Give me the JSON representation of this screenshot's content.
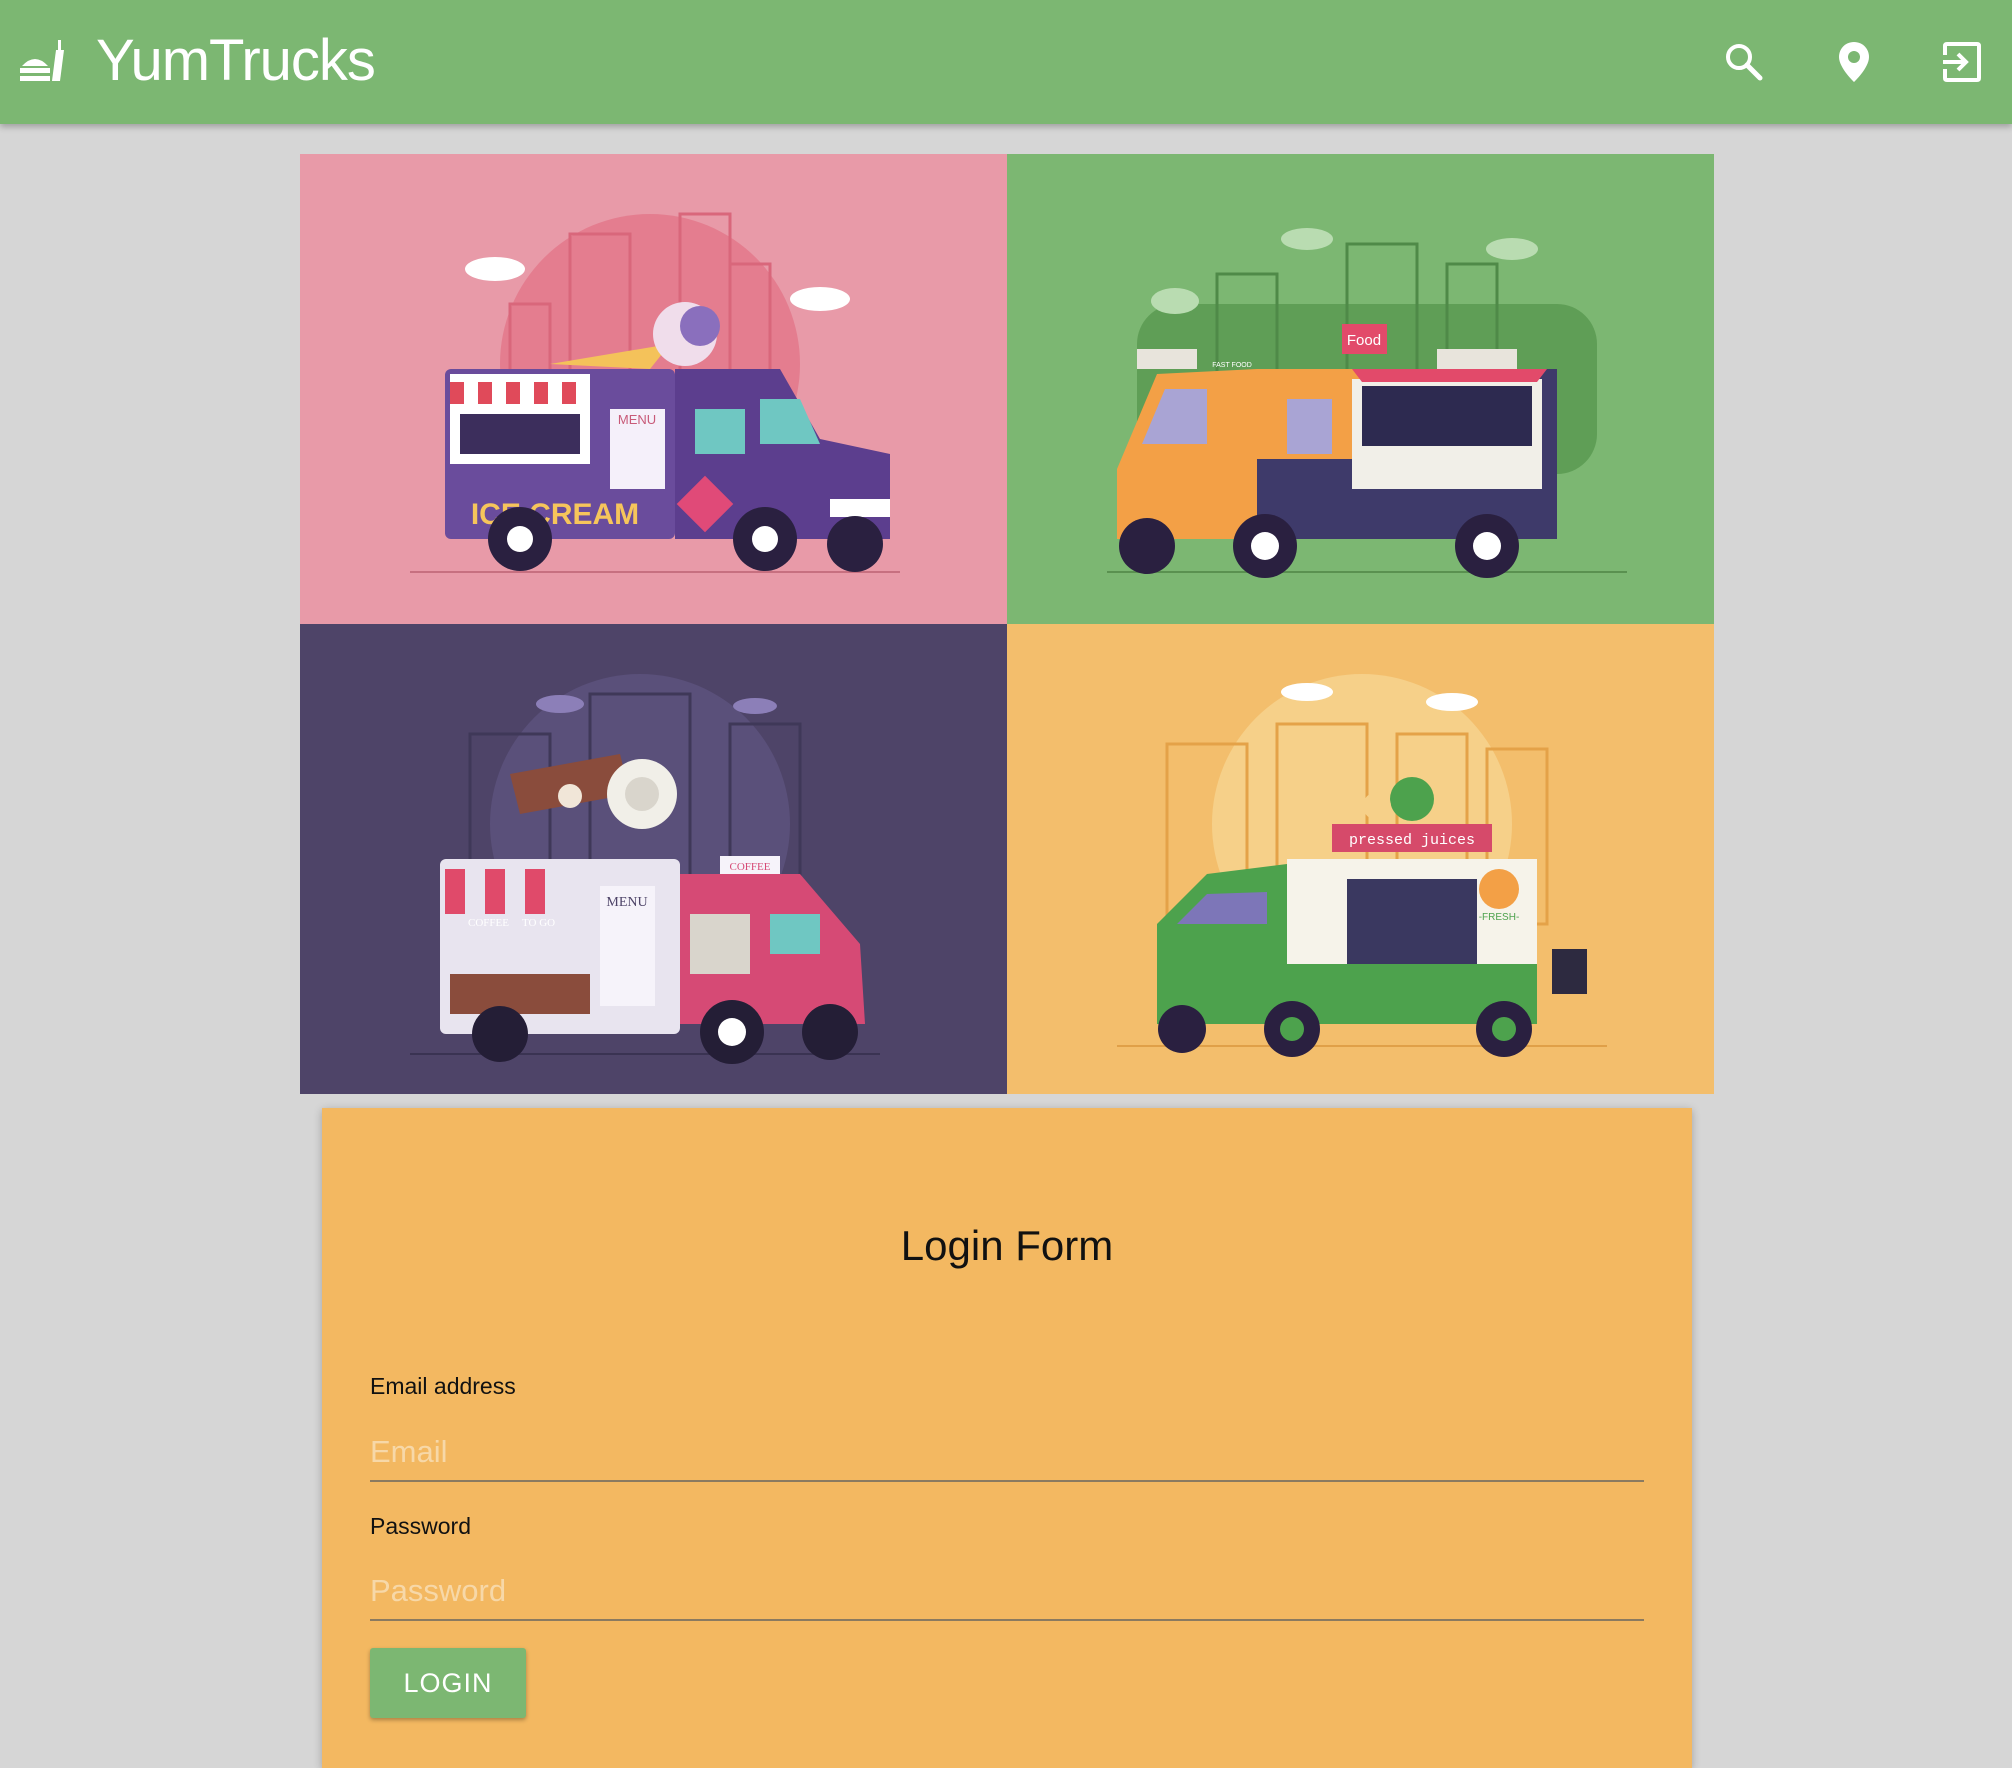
{
  "app": {
    "title": "YumTrucks",
    "brand_color": "#7cb772",
    "icons": [
      "food-truck-icon",
      "search-icon",
      "location-pin-icon",
      "login-icon"
    ]
  },
  "hero": {
    "tiles": [
      {
        "name": "ice-cream-truck",
        "background": "#e89aa8",
        "lettering": [
          "MENU",
          "ICE CREAM"
        ]
      },
      {
        "name": "fast-food-truck",
        "background": "#7cb772",
        "lettering": [
          "Food",
          "FAST FOOD"
        ]
      },
      {
        "name": "coffee-truck",
        "background": "#4e4468",
        "lettering": [
          "COFFEE",
          "COFFEE",
          "TO GO",
          "MENU"
        ]
      },
      {
        "name": "juice-truck",
        "background": "#f3be6c",
        "lettering": [
          "pressed juices",
          "FRESH"
        ]
      }
    ]
  },
  "login_form": {
    "title": "Login Form",
    "email_label": "Email address",
    "email_placeholder": "Email",
    "password_label": "Password",
    "password_placeholder": "Password",
    "submit_label": "LOGIN",
    "background": "#f3b861"
  }
}
